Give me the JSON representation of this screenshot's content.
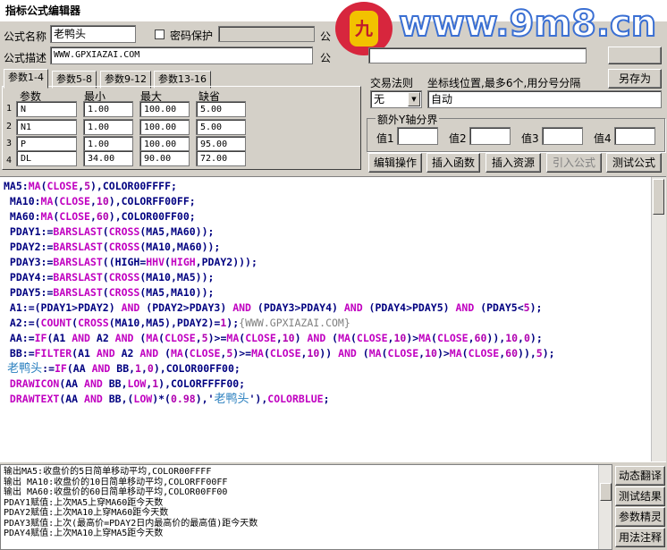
{
  "window": {
    "title": "指标公式编辑器"
  },
  "watermark": {
    "logo_text": "九",
    "site": "www.9m8.cn"
  },
  "form": {
    "name_label": "公式名称",
    "name_value": "老鸭头",
    "password_label": "密码保护",
    "password_checked": false,
    "desc_label": "公式描述",
    "desc_value": "WWW.GPXIAZAI.COM",
    "right_label_1": "公",
    "right_label_2": "公"
  },
  "tabs": [
    "参数1-4",
    "参数5-8",
    "参数9-12",
    "参数13-16"
  ],
  "params": {
    "headers": {
      "name": "参数",
      "min": "最小",
      "max": "最大",
      "default": "缺省"
    },
    "rows": [
      {
        "num": "1",
        "name": "N",
        "min": "1.00",
        "max": "100.00",
        "default": "5.00"
      },
      {
        "num": "2",
        "name": "N1",
        "min": "1.00",
        "max": "100.00",
        "default": "5.00"
      },
      {
        "num": "3",
        "name": "P",
        "min": "1.00",
        "max": "100.00",
        "default": "95.00"
      },
      {
        "num": "4",
        "name": "DL",
        "min": "34.00",
        "max": "90.00",
        "default": "72.00"
      }
    ]
  },
  "trade_rule": {
    "label": "交易法则",
    "value": "无"
  },
  "axis": {
    "label": "坐标线位置,最多6个,用分号分隔",
    "value": "自动"
  },
  "save_as_button": "另存为",
  "yaxis_group": {
    "title": "额外Y轴分界",
    "labels": [
      "值1",
      "值2",
      "值3",
      "值4"
    ]
  },
  "action_buttons": [
    "编辑操作",
    "插入函数",
    "插入资源",
    "引入公式",
    "测试公式"
  ],
  "code_lines": [
    [
      [
        "v",
        "MA5:"
      ],
      [
        "f",
        "MA"
      ],
      [
        "k",
        "("
      ],
      [
        "f",
        "CLOSE"
      ],
      [
        "k",
        ","
      ],
      [
        "n",
        "5"
      ],
      [
        "k",
        "),COLOR00FFFF;"
      ]
    ],
    [
      [
        "k",
        " MA10:"
      ],
      [
        "f",
        "MA"
      ],
      [
        "k",
        "("
      ],
      [
        "f",
        "CLOSE"
      ],
      [
        "k",
        ","
      ],
      [
        "n",
        "10"
      ],
      [
        "k",
        "),COLORFF00FF;"
      ]
    ],
    [
      [
        "k",
        " MA60:"
      ],
      [
        "f",
        "MA"
      ],
      [
        "k",
        "("
      ],
      [
        "f",
        "CLOSE"
      ],
      [
        "k",
        ","
      ],
      [
        "n",
        "60"
      ],
      [
        "k",
        "),COLOR00FF00;"
      ]
    ],
    [
      [
        "k",
        " PDAY1:="
      ],
      [
        "f",
        "BARSLAST"
      ],
      [
        "k",
        "("
      ],
      [
        "f",
        "CROSS"
      ],
      [
        "k",
        "(MA5,MA60));"
      ]
    ],
    [
      [
        "k",
        " PDAY2:="
      ],
      [
        "f",
        "BARSLAST"
      ],
      [
        "k",
        "("
      ],
      [
        "f",
        "CROSS"
      ],
      [
        "k",
        "(MA10,MA60));"
      ]
    ],
    [
      [
        "k",
        " PDAY3:="
      ],
      [
        "f",
        "BARSLAST"
      ],
      [
        "k",
        "((HIGH="
      ],
      [
        "f",
        "HHV"
      ],
      [
        "k",
        "("
      ],
      [
        "f",
        "HIGH"
      ],
      [
        "k",
        ",PDAY2)));"
      ]
    ],
    [
      [
        "k",
        " PDAY4:="
      ],
      [
        "f",
        "BARSLAST"
      ],
      [
        "k",
        "("
      ],
      [
        "f",
        "CROSS"
      ],
      [
        "k",
        "(MA10,MA5));"
      ]
    ],
    [
      [
        "k",
        " PDAY5:="
      ],
      [
        "f",
        "BARSLAST"
      ],
      [
        "k",
        "("
      ],
      [
        "f",
        "CROSS"
      ],
      [
        "k",
        "(MA5,MA10));"
      ]
    ],
    [
      [
        "k",
        " A1:=(PDAY1>PDAY2) "
      ],
      [
        "f",
        "AND"
      ],
      [
        "k",
        " (PDAY2>PDAY3) "
      ],
      [
        "f",
        "AND"
      ],
      [
        "k",
        " (PDAY3>PDAY4) "
      ],
      [
        "f",
        "AND"
      ],
      [
        "k",
        " (PDAY4>PDAY5) "
      ],
      [
        "f",
        "AND"
      ],
      [
        "k",
        " (PDAY5<"
      ],
      [
        "n",
        "5"
      ],
      [
        "k",
        ");"
      ]
    ],
    [
      [
        "k",
        " A2:=("
      ],
      [
        "f",
        "COUNT"
      ],
      [
        "k",
        "("
      ],
      [
        "f",
        "CROSS"
      ],
      [
        "k",
        "(MA10,MA5),PDAY2)="
      ],
      [
        "n",
        "1"
      ],
      [
        "k",
        ");"
      ],
      [
        "c",
        "{WWW.GPXIAZAI.COM}"
      ]
    ],
    [
      [
        "k",
        " AA:="
      ],
      [
        "f",
        "IF"
      ],
      [
        "k",
        "(A1 "
      ],
      [
        "f",
        "AND"
      ],
      [
        "k",
        " A2 "
      ],
      [
        "f",
        "AND"
      ],
      [
        "k",
        " ("
      ],
      [
        "f",
        "MA"
      ],
      [
        "k",
        "("
      ],
      [
        "f",
        "CLOSE"
      ],
      [
        "k",
        ","
      ],
      [
        "n",
        "5"
      ],
      [
        "k",
        ")>="
      ],
      [
        "f",
        "MA"
      ],
      [
        "k",
        "("
      ],
      [
        "f",
        "CLOSE"
      ],
      [
        "k",
        ","
      ],
      [
        "n",
        "10"
      ],
      [
        "k",
        ") "
      ],
      [
        "f",
        "AND"
      ],
      [
        "k",
        " ("
      ],
      [
        "f",
        "MA"
      ],
      [
        "k",
        "("
      ],
      [
        "f",
        "CLOSE"
      ],
      [
        "k",
        ","
      ],
      [
        "n",
        "10"
      ],
      [
        "k",
        ")>"
      ],
      [
        "f",
        "MA"
      ],
      [
        "k",
        "("
      ],
      [
        "f",
        "CLOSE"
      ],
      [
        "k",
        ","
      ],
      [
        "n",
        "60"
      ],
      [
        "k",
        ")),"
      ],
      [
        "n",
        "10"
      ],
      [
        "k",
        ","
      ],
      [
        "n",
        "0"
      ],
      [
        "k",
        ");"
      ]
    ],
    [
      [
        "k",
        " BB:="
      ],
      [
        "f",
        "FILTER"
      ],
      [
        "k",
        "(A1 "
      ],
      [
        "f",
        "AND"
      ],
      [
        "k",
        " A2 "
      ],
      [
        "f",
        "AND"
      ],
      [
        "k",
        " ("
      ],
      [
        "f",
        "MA"
      ],
      [
        "k",
        "("
      ],
      [
        "f",
        "CLOSE"
      ],
      [
        "k",
        ","
      ],
      [
        "n",
        "5"
      ],
      [
        "k",
        ")>="
      ],
      [
        "f",
        "MA"
      ],
      [
        "k",
        "("
      ],
      [
        "f",
        "CLOSE"
      ],
      [
        "k",
        ","
      ],
      [
        "n",
        "10"
      ],
      [
        "k",
        ")) "
      ],
      [
        "f",
        "AND"
      ],
      [
        "k",
        " ("
      ],
      [
        "f",
        "MA"
      ],
      [
        "k",
        "("
      ],
      [
        "f",
        "CLOSE"
      ],
      [
        "k",
        ","
      ],
      [
        "n",
        "10"
      ],
      [
        "k",
        ")>"
      ],
      [
        "f",
        "MA"
      ],
      [
        "k",
        "("
      ],
      [
        "f",
        "CLOSE"
      ],
      [
        "k",
        ","
      ],
      [
        "n",
        "60"
      ],
      [
        "k",
        ")),"
      ],
      [
        "n",
        "5"
      ],
      [
        "k",
        ");"
      ]
    ],
    [
      [
        "cn",
        " 老鸭头"
      ],
      [
        "k",
        ":="
      ],
      [
        "f",
        "IF"
      ],
      [
        "k",
        "(AA "
      ],
      [
        "f",
        "AND"
      ],
      [
        "k",
        " BB,"
      ],
      [
        "n",
        "1"
      ],
      [
        "k",
        ","
      ],
      [
        "n",
        "0"
      ],
      [
        "k",
        "),COLOR00FF00;"
      ]
    ],
    [
      [
        "f",
        " DRAWICON"
      ],
      [
        "k",
        "(AA "
      ],
      [
        "f",
        "AND"
      ],
      [
        "k",
        " BB,"
      ],
      [
        "f",
        "LOW"
      ],
      [
        "k",
        ","
      ],
      [
        "n",
        "1"
      ],
      [
        "k",
        "),COLORFFFF00;"
      ]
    ],
    [
      [
        "f",
        " DRAWTEXT"
      ],
      [
        "k",
        "(AA "
      ],
      [
        "f",
        "AND"
      ],
      [
        "k",
        " BB,("
      ],
      [
        "f",
        "LOW"
      ],
      [
        "k",
        ")*("
      ],
      [
        "n",
        "0.98"
      ],
      [
        "k",
        "),'"
      ],
      [
        "cn",
        "老鸭头"
      ],
      [
        "k",
        "'),"
      ],
      [
        "f",
        "COLORBLUE"
      ],
      [
        "k",
        ";"
      ]
    ]
  ],
  "output_lines": [
    "输出MA5:收盘价的5日简单移动平均,COLOR00FFFF",
    "输出 MA10:收盘价的10日简单移动平均,COLORFF00FF",
    "输出 MA60:收盘价的60日简单移动平均,COLOR00FF00",
    "PDAY1赋值:上次MA5上穿MA60距今天数",
    "PDAY2赋值:上次MA10上穿MA60距今天数",
    "PDAY3赋值:上次(最高价=PDAY2日内最高价的最高值)距今天数",
    "PDAY4赋值:上次MA10上穿MA5距今天数"
  ],
  "side_buttons": [
    "动态翻译",
    "测试结果",
    "参数精灵",
    "用法注释"
  ]
}
